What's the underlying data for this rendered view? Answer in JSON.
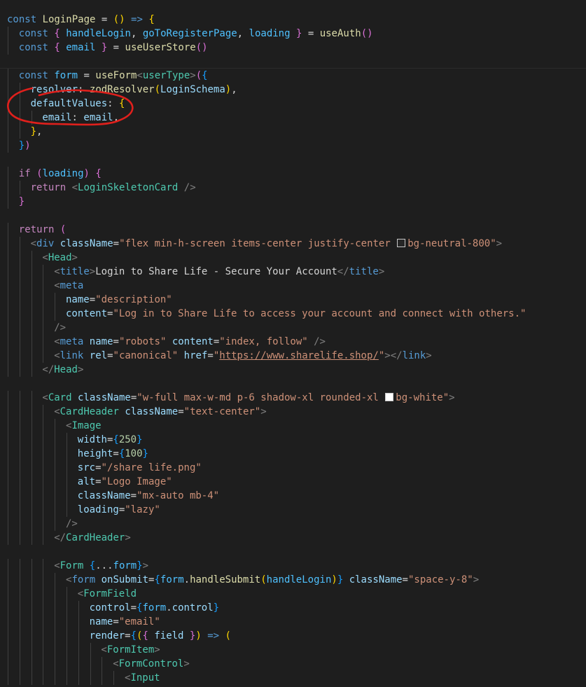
{
  "palette": {
    "keyword": "#569cd6",
    "control": "#c586c0",
    "function": "#dcdcaa",
    "type": "#4ec9b0",
    "variable": "#9cdcfe",
    "constant": "#4fc1ff",
    "string": "#ce9178",
    "number": "#b5cea8",
    "tag": "#569cd6",
    "component": "#4ec9b0",
    "attr": "#9cdcfe",
    "punct": "#d4d4d4",
    "bracket_gold": "#ffd700",
    "bracket_pink": "#da70d6",
    "bracket_blue": "#179fff",
    "angle": "#808080",
    "annotation": "#e0201c"
  },
  "code_lines": [
    {
      "indent": 0,
      "tokens": [
        [
          "const ",
          "keyword"
        ],
        [
          "LoginPage",
          "function"
        ],
        [
          " = ",
          "punct"
        ],
        [
          "(",
          "bracket_gold"
        ],
        [
          ")",
          "bracket_gold"
        ],
        [
          " => ",
          "keyword"
        ],
        [
          "{",
          "bracket_gold"
        ]
      ]
    },
    {
      "indent": 1,
      "tokens": [
        [
          "const ",
          "keyword"
        ],
        [
          "{ ",
          "bracket_pink"
        ],
        [
          "handleLogin",
          "constant"
        ],
        [
          ", ",
          "punct"
        ],
        [
          "goToRegisterPage",
          "constant"
        ],
        [
          ", ",
          "punct"
        ],
        [
          "loading",
          "constant"
        ],
        [
          " }",
          "bracket_pink"
        ],
        [
          " = ",
          "punct"
        ],
        [
          "useAuth",
          "function"
        ],
        [
          "()",
          "bracket_pink"
        ]
      ]
    },
    {
      "indent": 1,
      "tokens": [
        [
          "const ",
          "keyword"
        ],
        [
          "{ ",
          "bracket_pink"
        ],
        [
          "email",
          "constant"
        ],
        [
          " }",
          "bracket_pink"
        ],
        [
          " = ",
          "punct"
        ],
        [
          "useUserStore",
          "function"
        ],
        [
          "()",
          "bracket_pink"
        ]
      ]
    },
    {
      "indent": 0,
      "tokens": []
    },
    {
      "indent": 1,
      "tokens": [
        [
          "const ",
          "keyword"
        ],
        [
          "form",
          "constant"
        ],
        [
          " = ",
          "punct"
        ],
        [
          "useForm",
          "function"
        ],
        [
          "<",
          "angle"
        ],
        [
          "userType",
          "type"
        ],
        [
          ">",
          "angle"
        ],
        [
          "(",
          "bracket_pink"
        ],
        [
          "{",
          "bracket_blue"
        ]
      ]
    },
    {
      "indent": 2,
      "tokens": [
        [
          "resolver",
          "variable"
        ],
        [
          ": ",
          "punct"
        ],
        [
          "zodResolver",
          "function"
        ],
        [
          "(",
          "bracket_gold"
        ],
        [
          "LoginSchema",
          "variable"
        ],
        [
          ")",
          "bracket_gold"
        ],
        [
          ",",
          "punct"
        ]
      ]
    },
    {
      "indent": 2,
      "tokens": [
        [
          "defaultValues",
          "variable"
        ],
        [
          ": ",
          "punct"
        ],
        [
          "{",
          "bracket_gold"
        ]
      ]
    },
    {
      "indent": 3,
      "tokens": [
        [
          "email",
          "variable"
        ],
        [
          ": ",
          "punct"
        ],
        [
          "email",
          "variable"
        ],
        [
          ",",
          "punct"
        ]
      ]
    },
    {
      "indent": 2,
      "tokens": [
        [
          "}",
          "bracket_gold"
        ],
        [
          ",",
          "punct"
        ]
      ]
    },
    {
      "indent": 1,
      "tokens": [
        [
          "}",
          "bracket_blue"
        ],
        [
          ")",
          "bracket_pink"
        ]
      ]
    },
    {
      "indent": 0,
      "tokens": []
    },
    {
      "indent": 1,
      "tokens": [
        [
          "if ",
          "control"
        ],
        [
          "(",
          "bracket_pink"
        ],
        [
          "loading",
          "constant"
        ],
        [
          ")",
          "bracket_pink"
        ],
        [
          " ",
          "punct"
        ],
        [
          "{",
          "bracket_pink"
        ]
      ]
    },
    {
      "indent": 2,
      "tokens": [
        [
          "return ",
          "control"
        ],
        [
          "<",
          "angle"
        ],
        [
          "LoginSkeletonCard",
          "component"
        ],
        [
          " />",
          "angle"
        ]
      ]
    },
    {
      "indent": 1,
      "tokens": [
        [
          "}",
          "bracket_pink"
        ]
      ]
    },
    {
      "indent": 0,
      "tokens": []
    },
    {
      "indent": 1,
      "tokens": [
        [
          "return ",
          "control"
        ],
        [
          "(",
          "bracket_pink"
        ]
      ]
    },
    {
      "indent": 2,
      "tokens": [
        [
          "<",
          "angle"
        ],
        [
          "div",
          "tag"
        ],
        [
          " ",
          "punct"
        ],
        [
          "className",
          "attr"
        ],
        [
          "=",
          "punct"
        ],
        [
          "\"flex min-h-screen items-center justify-center ",
          "string"
        ],
        [
          "",
          "swatch_dark"
        ],
        [
          "bg-neutral-800\"",
          "string"
        ],
        [
          ">",
          "angle"
        ]
      ]
    },
    {
      "indent": 3,
      "tokens": [
        [
          "<",
          "angle"
        ],
        [
          "Head",
          "component"
        ],
        [
          ">",
          "angle"
        ]
      ]
    },
    {
      "indent": 4,
      "tokens": [
        [
          "<",
          "angle"
        ],
        [
          "title",
          "tag"
        ],
        [
          ">",
          "angle"
        ],
        [
          "Login to Share Life - Secure Your Account",
          "punct"
        ],
        [
          "</",
          "angle"
        ],
        [
          "title",
          "tag"
        ],
        [
          ">",
          "angle"
        ]
      ]
    },
    {
      "indent": 4,
      "tokens": [
        [
          "<",
          "angle"
        ],
        [
          "meta",
          "tag"
        ]
      ]
    },
    {
      "indent": 5,
      "tokens": [
        [
          "name",
          "attr"
        ],
        [
          "=",
          "punct"
        ],
        [
          "\"description\"",
          "string"
        ]
      ]
    },
    {
      "indent": 5,
      "tokens": [
        [
          "content",
          "attr"
        ],
        [
          "=",
          "punct"
        ],
        [
          "\"Log in to Share Life to access your account and connect with others.\"",
          "string"
        ]
      ]
    },
    {
      "indent": 4,
      "tokens": [
        [
          "/>",
          "angle"
        ]
      ]
    },
    {
      "indent": 4,
      "tokens": [
        [
          "<",
          "angle"
        ],
        [
          "meta",
          "tag"
        ],
        [
          " ",
          "punct"
        ],
        [
          "name",
          "attr"
        ],
        [
          "=",
          "punct"
        ],
        [
          "\"robots\"",
          "string"
        ],
        [
          " ",
          "punct"
        ],
        [
          "content",
          "attr"
        ],
        [
          "=",
          "punct"
        ],
        [
          "\"index, follow\"",
          "string"
        ],
        [
          " />",
          "angle"
        ]
      ]
    },
    {
      "indent": 4,
      "tokens": [
        [
          "<",
          "angle"
        ],
        [
          "link",
          "tag"
        ],
        [
          " ",
          "punct"
        ],
        [
          "rel",
          "attr"
        ],
        [
          "=",
          "punct"
        ],
        [
          "\"canonical\"",
          "string"
        ],
        [
          " ",
          "punct"
        ],
        [
          "href",
          "attr"
        ],
        [
          "=",
          "punct"
        ],
        [
          "\"",
          "string"
        ],
        [
          "https://www.sharelife.shop/",
          "string_link"
        ],
        [
          "\"",
          "string"
        ],
        [
          "></",
          "angle"
        ],
        [
          "link",
          "tag"
        ],
        [
          ">",
          "angle"
        ]
      ]
    },
    {
      "indent": 3,
      "tokens": [
        [
          "</",
          "angle"
        ],
        [
          "Head",
          "component"
        ],
        [
          ">",
          "angle"
        ]
      ]
    },
    {
      "indent": 0,
      "tokens": []
    },
    {
      "indent": 3,
      "tokens": [
        [
          "<",
          "angle"
        ],
        [
          "Card",
          "component"
        ],
        [
          " ",
          "punct"
        ],
        [
          "className",
          "attr"
        ],
        [
          "=",
          "punct"
        ],
        [
          "\"w-full max-w-md p-6 shadow-xl rounded-xl ",
          "string"
        ],
        [
          "",
          "swatch_white"
        ],
        [
          "bg-white\"",
          "string"
        ],
        [
          ">",
          "angle"
        ]
      ]
    },
    {
      "indent": 4,
      "tokens": [
        [
          "<",
          "angle"
        ],
        [
          "CardHeader",
          "component"
        ],
        [
          " ",
          "punct"
        ],
        [
          "className",
          "attr"
        ],
        [
          "=",
          "punct"
        ],
        [
          "\"text-center\"",
          "string"
        ],
        [
          ">",
          "angle"
        ]
      ]
    },
    {
      "indent": 5,
      "tokens": [
        [
          "<",
          "angle"
        ],
        [
          "Image",
          "component"
        ]
      ]
    },
    {
      "indent": 6,
      "tokens": [
        [
          "width",
          "attr"
        ],
        [
          "=",
          "punct"
        ],
        [
          "{",
          "bracket_blue"
        ],
        [
          "250",
          "number"
        ],
        [
          "}",
          "bracket_blue"
        ]
      ]
    },
    {
      "indent": 6,
      "tokens": [
        [
          "height",
          "attr"
        ],
        [
          "=",
          "punct"
        ],
        [
          "{",
          "bracket_blue"
        ],
        [
          "100",
          "number"
        ],
        [
          "}",
          "bracket_blue"
        ]
      ]
    },
    {
      "indent": 6,
      "tokens": [
        [
          "src",
          "attr"
        ],
        [
          "=",
          "punct"
        ],
        [
          "\"/share life.png\"",
          "string"
        ]
      ]
    },
    {
      "indent": 6,
      "tokens": [
        [
          "alt",
          "attr"
        ],
        [
          "=",
          "punct"
        ],
        [
          "\"Logo Image\"",
          "string"
        ]
      ]
    },
    {
      "indent": 6,
      "tokens": [
        [
          "className",
          "attr"
        ],
        [
          "=",
          "punct"
        ],
        [
          "\"mx-auto mb-4\"",
          "string"
        ]
      ]
    },
    {
      "indent": 6,
      "tokens": [
        [
          "loading",
          "attr"
        ],
        [
          "=",
          "punct"
        ],
        [
          "\"lazy\"",
          "string"
        ]
      ]
    },
    {
      "indent": 5,
      "tokens": [
        [
          "/>",
          "angle"
        ]
      ]
    },
    {
      "indent": 4,
      "tokens": [
        [
          "</",
          "angle"
        ],
        [
          "CardHeader",
          "component"
        ],
        [
          ">",
          "angle"
        ]
      ]
    },
    {
      "indent": 0,
      "tokens": []
    },
    {
      "indent": 4,
      "tokens": [
        [
          "<",
          "angle"
        ],
        [
          "Form",
          "component"
        ],
        [
          " ",
          "punct"
        ],
        [
          "{",
          "bracket_blue"
        ],
        [
          "...",
          "punct"
        ],
        [
          "form",
          "constant"
        ],
        [
          "}",
          "bracket_blue"
        ],
        [
          ">",
          "angle"
        ]
      ]
    },
    {
      "indent": 5,
      "tokens": [
        [
          "<",
          "angle"
        ],
        [
          "form",
          "tag"
        ],
        [
          " ",
          "punct"
        ],
        [
          "onSubmit",
          "attr"
        ],
        [
          "=",
          "punct"
        ],
        [
          "{",
          "bracket_blue"
        ],
        [
          "form",
          "constant"
        ],
        [
          ".",
          "punct"
        ],
        [
          "handleSubmit",
          "function"
        ],
        [
          "(",
          "bracket_gold"
        ],
        [
          "handleLogin",
          "constant"
        ],
        [
          ")",
          "bracket_gold"
        ],
        [
          "}",
          "bracket_blue"
        ],
        [
          " ",
          "punct"
        ],
        [
          "className",
          "attr"
        ],
        [
          "=",
          "punct"
        ],
        [
          "\"space-y-8\"",
          "string"
        ],
        [
          ">",
          "angle"
        ]
      ]
    },
    {
      "indent": 6,
      "tokens": [
        [
          "<",
          "angle"
        ],
        [
          "FormField",
          "component"
        ]
      ]
    },
    {
      "indent": 7,
      "tokens": [
        [
          "control",
          "attr"
        ],
        [
          "=",
          "punct"
        ],
        [
          "{",
          "bracket_blue"
        ],
        [
          "form",
          "constant"
        ],
        [
          ".",
          "punct"
        ],
        [
          "control",
          "variable"
        ],
        [
          "}",
          "bracket_blue"
        ]
      ]
    },
    {
      "indent": 7,
      "tokens": [
        [
          "name",
          "attr"
        ],
        [
          "=",
          "punct"
        ],
        [
          "\"email\"",
          "string"
        ]
      ]
    },
    {
      "indent": 7,
      "tokens": [
        [
          "render",
          "attr"
        ],
        [
          "=",
          "punct"
        ],
        [
          "{",
          "bracket_blue"
        ],
        [
          "(",
          "bracket_gold"
        ],
        [
          "{ ",
          "bracket_pink"
        ],
        [
          "field",
          "variable"
        ],
        [
          " }",
          "bracket_pink"
        ],
        [
          ")",
          "bracket_gold"
        ],
        [
          " => ",
          "keyword"
        ],
        [
          "(",
          "bracket_gold"
        ]
      ]
    },
    {
      "indent": 8,
      "tokens": [
        [
          "<",
          "angle"
        ],
        [
          "FormItem",
          "component"
        ],
        [
          ">",
          "angle"
        ]
      ]
    },
    {
      "indent": 9,
      "tokens": [
        [
          "<",
          "angle"
        ],
        [
          "FormControl",
          "component"
        ],
        [
          ">",
          "angle"
        ]
      ]
    },
    {
      "indent": 10,
      "tokens": [
        [
          "<",
          "angle"
        ],
        [
          "Input",
          "component"
        ]
      ]
    }
  ]
}
